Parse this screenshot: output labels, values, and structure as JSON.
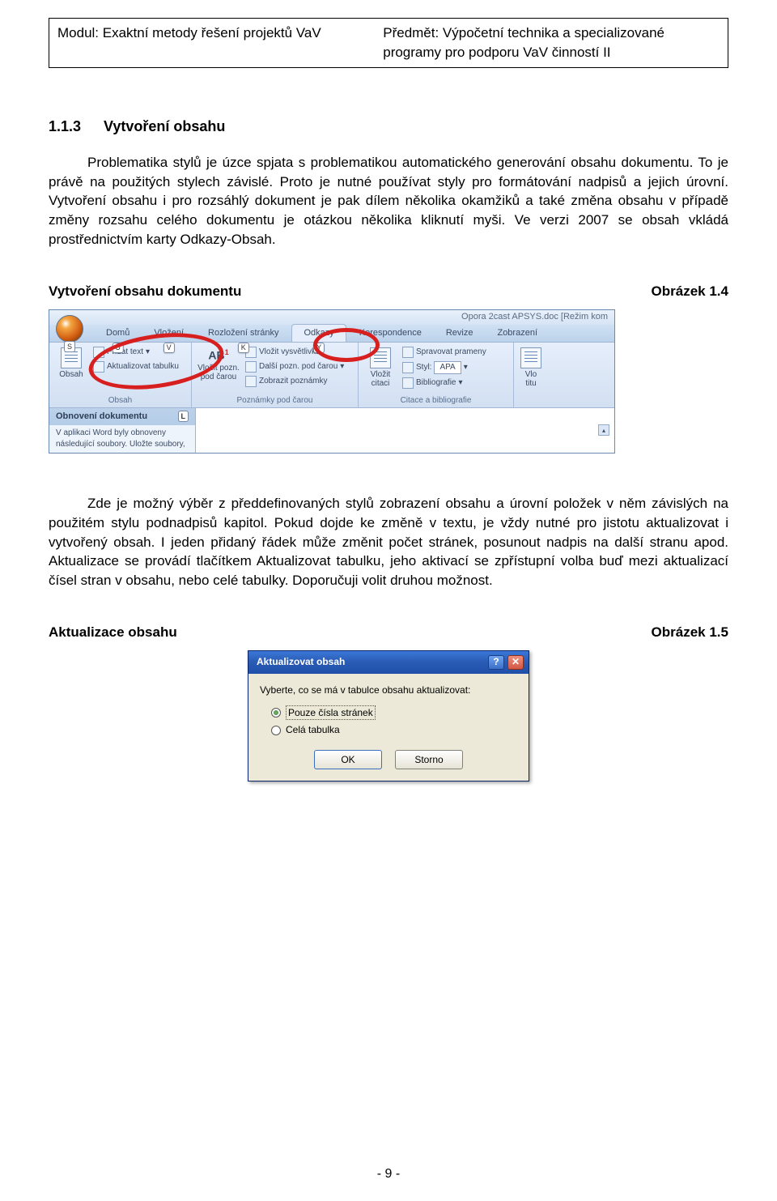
{
  "header": {
    "left": "Modul: Exaktní metody řešení projektů VaV",
    "right": "Předmět: Výpočetní technika a specializované programy pro podporu VaV činností II"
  },
  "section": {
    "num": "1.1.3",
    "title": "Vytvoření obsahu"
  },
  "para1": "Problematika stylů je úzce spjata s problematikou automatického generování obsahu dokumentu. To je právě na použitých stylech závislé. Proto je nutné používat styly pro formátování nadpisů a jejich úrovní. Vytvoření obsahu i pro rozsáhlý dokument je pak dílem několika okamžiků a také změna obsahu v případě změny rozsahu celého dokumentu je otázkou několika kliknutí myši. Ve verzi 2007 se obsah vkládá prostřednictvím karty Odkazy-Obsah.",
  "fig1": {
    "caption": "Vytvoření obsahu dokumentu",
    "ref": "Obrázek 1.4"
  },
  "ribbon": {
    "titlebar": "Opora 2cast APSYS.doc [Režim kom",
    "office_key": "S",
    "tabs": [
      {
        "label": "Domů",
        "key": "Ů"
      },
      {
        "label": "Vložení",
        "key": "V"
      },
      {
        "label": "Rozložení stránky",
        "key": "K"
      },
      {
        "label": "Odkazy",
        "key": "Y",
        "active": true
      },
      {
        "label": "Korespondence",
        "key": ""
      },
      {
        "label": "Revize",
        "key": ""
      },
      {
        "label": "Zobrazení",
        "key": ""
      }
    ],
    "groups": {
      "obsah": {
        "big": "Obsah",
        "add_text": "Přidat text",
        "update": "Aktualizovat tabulku",
        "label": "Obsah"
      },
      "pozn": {
        "big1": "Vložit pozn. pod čarou",
        "ab": "AB",
        "note1": "Vložit vysvětlivku",
        "note2": "Další pozn. pod čarou",
        "note3": "Zobrazit poznámky",
        "label": "Poznámky pod čarou"
      },
      "cit": {
        "big": "Vložit citaci",
        "manage": "Spravovat prameny",
        "style": "Styl:",
        "style_val": "APA",
        "bib": "Bibliografie",
        "label": "Citace a bibliografie"
      },
      "titulky": {
        "big": "Vlo titu"
      }
    },
    "recovery": {
      "title": "Obnovení dokumentu",
      "key": "L",
      "body": "V aplikaci Word byly obnoveny následující soubory. Uložte soubory,"
    }
  },
  "para2": "Zde je možný výběr z předdefinovaných stylů zobrazení obsahu a úrovní položek v něm závislých na použitém stylu podnadpisů kapitol. Pokud dojde ke změně v textu, je vždy nutné pro jistotu aktualizovat i vytvořený obsah. I jeden přidaný řádek může změnit počet stránek, posunout nadpis na další stranu apod. Aktualizace se provádí tlačítkem Aktualizovat tabulku, jeho aktivací se zpřístupní volba buď mezi aktualizací čísel stran v obsahu, nebo celé tabulky. Doporučuji volit druhou možnost.",
  "fig2": {
    "caption": "Aktualizace obsahu",
    "ref": "Obrázek 1.5"
  },
  "dialog": {
    "title": "Aktualizovat obsah",
    "msg": "Vyberte, co se má v tabulce obsahu aktualizovat:",
    "opt1": "Pouze čísla stránek",
    "opt2": "Celá tabulka",
    "ok": "OK",
    "cancel": "Storno"
  },
  "page_num": "- 9 -"
}
